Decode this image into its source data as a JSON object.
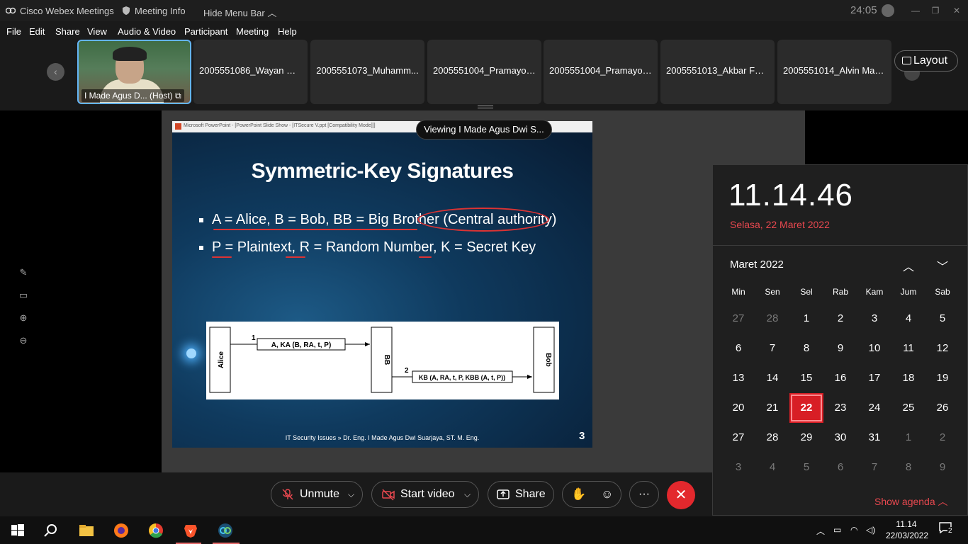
{
  "titlebar": {
    "app_title": "Cisco Webex Meetings",
    "meeting_info": "Meeting Info",
    "hide_menu": "Hide Menu Bar",
    "meeting_time": "24:05"
  },
  "menu": [
    "File",
    "Edit",
    "Share",
    "View",
    "Audio & Video",
    "Participant",
    "Meeting",
    "Help"
  ],
  "participants": {
    "host_label": "I Made Agus D... (Host)",
    "others": [
      "2005551086_Wayan De...",
      "2005551073_Muhamm...",
      "2005551004_Pramayot...",
      "2005551004_Pramayot...",
      "2005551013_Akbar Fern...",
      "2005551014_Alvin Maul..."
    ],
    "layout_label": "Layout"
  },
  "viewing_pill": "Viewing I Made Agus Dwi S...",
  "slide": {
    "window_title": "Microsoft PowerPoint - [PowerPoint Slide Show - [ITSecure V.ppt [Compatibility Mode]]]",
    "title": "Symmetric-Key Signatures",
    "bullet1": "A = Alice, B = Bob, BB = Big Brother (Central authority)",
    "bullet2": "P = Plaintext, R = Random Number, K = Secret Key",
    "diagram": {
      "alice": "Alice",
      "bb": "BB",
      "bob": "Bob",
      "step1": "1",
      "step2": "2",
      "msg1": "A, KA (B, RA, t, P)",
      "msg2": "KB (A, RA, t, P, KBB (A, t, P))"
    },
    "footer": "IT Security Issues » Dr. Eng. I Made Agus Dwi Suarjaya, ST. M. Eng.",
    "number": "3"
  },
  "controls": {
    "unmute": "Unmute",
    "start_video": "Start video",
    "share": "Share"
  },
  "clock": {
    "time": "11.14.46",
    "date": "Selasa, 22 Maret 2022",
    "month": "Maret 2022",
    "weekdays": [
      "Min",
      "Sen",
      "Sel",
      "Rab",
      "Kam",
      "Jum",
      "Sab"
    ],
    "days": [
      [
        "27",
        "28",
        "1",
        "2",
        "3",
        "4",
        "5"
      ],
      [
        "6",
        "7",
        "8",
        "9",
        "10",
        "11",
        "12"
      ],
      [
        "13",
        "14",
        "15",
        "16",
        "17",
        "18",
        "19"
      ],
      [
        "20",
        "21",
        "22",
        "23",
        "24",
        "25",
        "26"
      ],
      [
        "27",
        "28",
        "29",
        "30",
        "31",
        "1",
        "2"
      ],
      [
        "3",
        "4",
        "5",
        "6",
        "7",
        "8",
        "9"
      ]
    ],
    "today": "22",
    "show_agenda": "Show agenda"
  },
  "taskbar": {
    "time": "11.14",
    "date": "22/03/2022",
    "notifications": "2"
  },
  "colors": {
    "accent_red": "#d81e25",
    "leave_red": "#e3282d",
    "host_border": "#64b5f6"
  }
}
